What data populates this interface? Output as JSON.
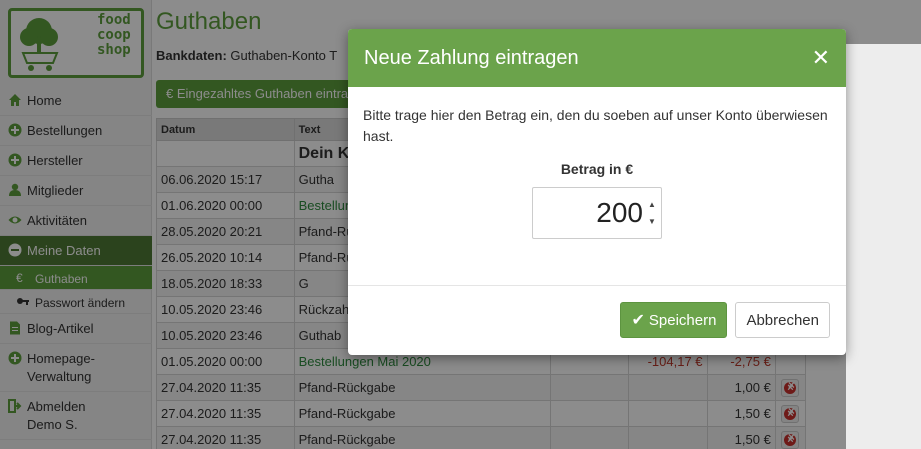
{
  "logo": {
    "words": [
      "food",
      "coop",
      "shop"
    ]
  },
  "sidebar": {
    "items": [
      {
        "label": "Home",
        "icon": "home-icon"
      },
      {
        "label": "Bestellungen",
        "icon": "plus-circle-icon"
      },
      {
        "label": "Hersteller",
        "icon": "plus-circle-icon"
      },
      {
        "label": "Mitglieder",
        "icon": "user-icon"
      },
      {
        "label": "Aktivitäten",
        "icon": "eye-icon"
      },
      {
        "label": "Meine Daten",
        "icon": "minus-circle-icon"
      },
      {
        "label": "Guthaben",
        "icon": "euro-icon"
      },
      {
        "label": "Passwort ändern",
        "icon": "key-icon"
      },
      {
        "label": "Blog-Artikel",
        "icon": "file-icon"
      },
      {
        "label": "Homepage-Verwaltung",
        "icon": "plus-circle-icon"
      },
      {
        "label": "Abmelden Demo S.",
        "icon": "sign-out-icon"
      }
    ]
  },
  "main": {
    "title": "Guthaben",
    "bank_label": "Bankdaten:",
    "bank_value": "Guthaben-Konto T",
    "add_button": "Eingezahltes Guthaben eintragen",
    "table": {
      "headers": [
        "Datum",
        "Text"
      ],
      "title_row": "Dein K",
      "rows": [
        {
          "date": "06.06.2020 15:17",
          "text": "Gutha",
          "text_color": "default",
          "v1": "",
          "v2": "",
          "del": false
        },
        {
          "date": "01.06.2020 00:00",
          "text": "Bestellun",
          "text_color": "green",
          "v1": "",
          "v2": "",
          "del": false
        },
        {
          "date": "28.05.2020 20:21",
          "text": "Pfand-Rü",
          "text_color": "default",
          "v1": "",
          "v2": "",
          "del": false
        },
        {
          "date": "26.05.2020 10:14",
          "text": "Pfand-Rü",
          "text_color": "default",
          "v1": "",
          "v2": "",
          "del": false
        },
        {
          "date": "18.05.2020 18:33",
          "text": "G",
          "text_color": "default",
          "v1": "",
          "v2": "",
          "del": false
        },
        {
          "date": "10.05.2020 23:46",
          "text": "Rückzah",
          "text_color": "default",
          "v1": "",
          "v2": "",
          "del": false
        },
        {
          "date": "10.05.2020 23:46",
          "text": "Guthab",
          "text_color": "default",
          "v1": "",
          "v2": "",
          "del": false
        },
        {
          "date": "01.05.2020 00:00",
          "text": "Bestellungen Mai 2020",
          "text_color": "green",
          "v1": "-104,17 €",
          "v2": "-2,75 €",
          "del": false
        },
        {
          "date": "27.04.2020 11:35",
          "text": "Pfand-Rückgabe",
          "text_color": "default",
          "v1": "",
          "v2": "1,00 €",
          "del": true
        },
        {
          "date": "27.04.2020 11:35",
          "text": "Pfand-Rückgabe",
          "text_color": "default",
          "v1": "",
          "v2": "1,50 €",
          "del": true
        },
        {
          "date": "27.04.2020 11:35",
          "text": "Pfand-Rückgabe",
          "text_color": "default",
          "v1": "",
          "v2": "1,50 €",
          "del": true
        }
      ]
    }
  },
  "modal": {
    "title": "Neue Zahlung eintragen",
    "close_icon": "close-icon",
    "text": "Bitte trage hier den Betrag ein, den du soeben auf unser Konto überwiesen hast.",
    "amount_label": "Betrag in €",
    "amount_value": "200",
    "save_label": "Speichern",
    "cancel_label": "Abbrechen"
  },
  "colors": {
    "accent": "#6ba34b",
    "sidebar_active": "#4f7b35",
    "title": "#5d9e3d"
  }
}
